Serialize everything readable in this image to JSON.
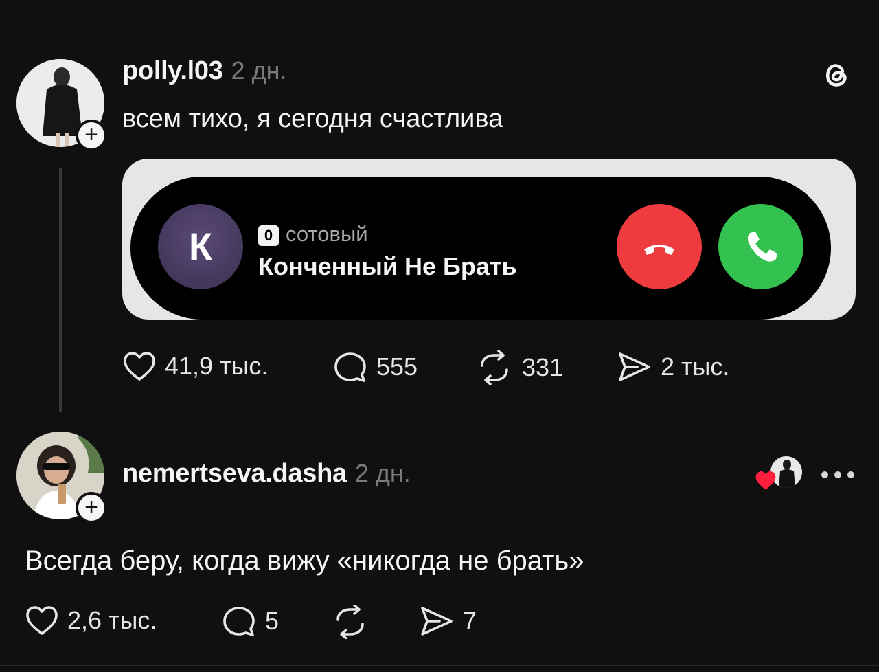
{
  "post": {
    "username": "polly.l03",
    "time": "2 дн.",
    "text": "всем тихо, я сегодня счастлива",
    "call_banner": {
      "caller_initial": "К",
      "sim_label": "0",
      "line_label": "сотовый",
      "caller_name": "Конченный Не Брать"
    },
    "actions": {
      "likes": "41,9 тыс.",
      "comments": "555",
      "reposts": "331",
      "shares": "2 тыс."
    }
  },
  "reply": {
    "username": "nemertseva.dasha",
    "time": "2 дн.",
    "text": "Всегда беру, когда вижу «никогда не брать»",
    "actions": {
      "likes": "2,6 тыс.",
      "comments": "5",
      "shares": "7"
    }
  },
  "colors": {
    "background": "#101010",
    "decline": "#ee3b3f",
    "accept": "#33c24f",
    "liked_heart": "#ff1f3d"
  },
  "icons": [
    "threads-logo-icon",
    "plus-icon",
    "heart-icon",
    "comment-icon",
    "repost-icon",
    "share-icon",
    "phone-icon",
    "more-icon"
  ]
}
